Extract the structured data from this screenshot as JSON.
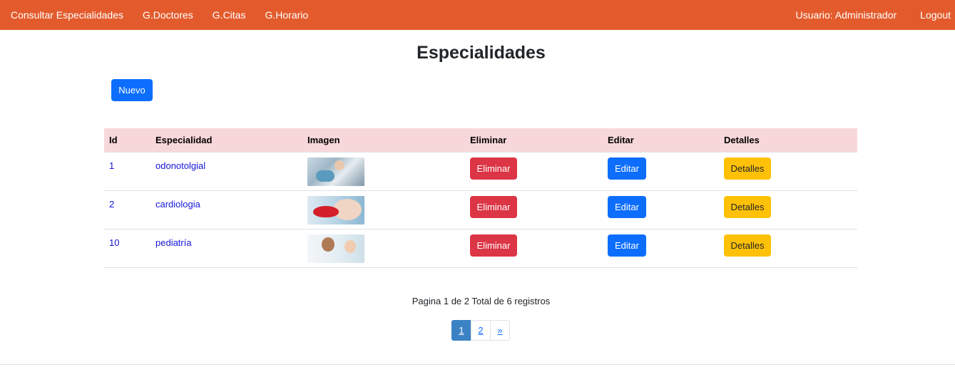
{
  "nav": {
    "left": [
      {
        "label": "Consultar Especialidades"
      },
      {
        "label": "G.Doctores"
      },
      {
        "label": "G.Citas"
      },
      {
        "label": "G.Horario"
      }
    ],
    "user_label": "Usuario: Administrador",
    "logout_label": "Logout",
    "bg_color": "#e35b2c"
  },
  "page": {
    "title": "Especialidades",
    "new_button_label": "Nuevo"
  },
  "table": {
    "headers": {
      "id": "Id",
      "especialidad": "Especialidad",
      "imagen": "Imagen",
      "eliminar": "Eliminar",
      "editar": "Editar",
      "detalles": "Detalles"
    },
    "rows": [
      {
        "id": "1",
        "especialidad": "odonotolgial",
        "image": "dental-photo",
        "eliminar": "Eliminar",
        "editar": "Editar",
        "detalles": "Detalles"
      },
      {
        "id": "2",
        "especialidad": "cardiologia",
        "image": "cardiology-photo",
        "eliminar": "Eliminar",
        "editar": "Editar",
        "detalles": "Detalles"
      },
      {
        "id": "10",
        "especialidad": "pediatría",
        "image": "pediatrics-photo",
        "eliminar": "Eliminar",
        "editar": "Editar",
        "detalles": "Detalles"
      }
    ]
  },
  "pagination": {
    "summary": "Pagina 1 de 2 Total de 6 registros",
    "pages": [
      "1",
      "2"
    ],
    "next": "»",
    "active": "1"
  },
  "colors": {
    "header_row": "#f8d7da",
    "primary": "#0d6efd",
    "danger": "#dc3545",
    "warning": "#ffc107"
  }
}
